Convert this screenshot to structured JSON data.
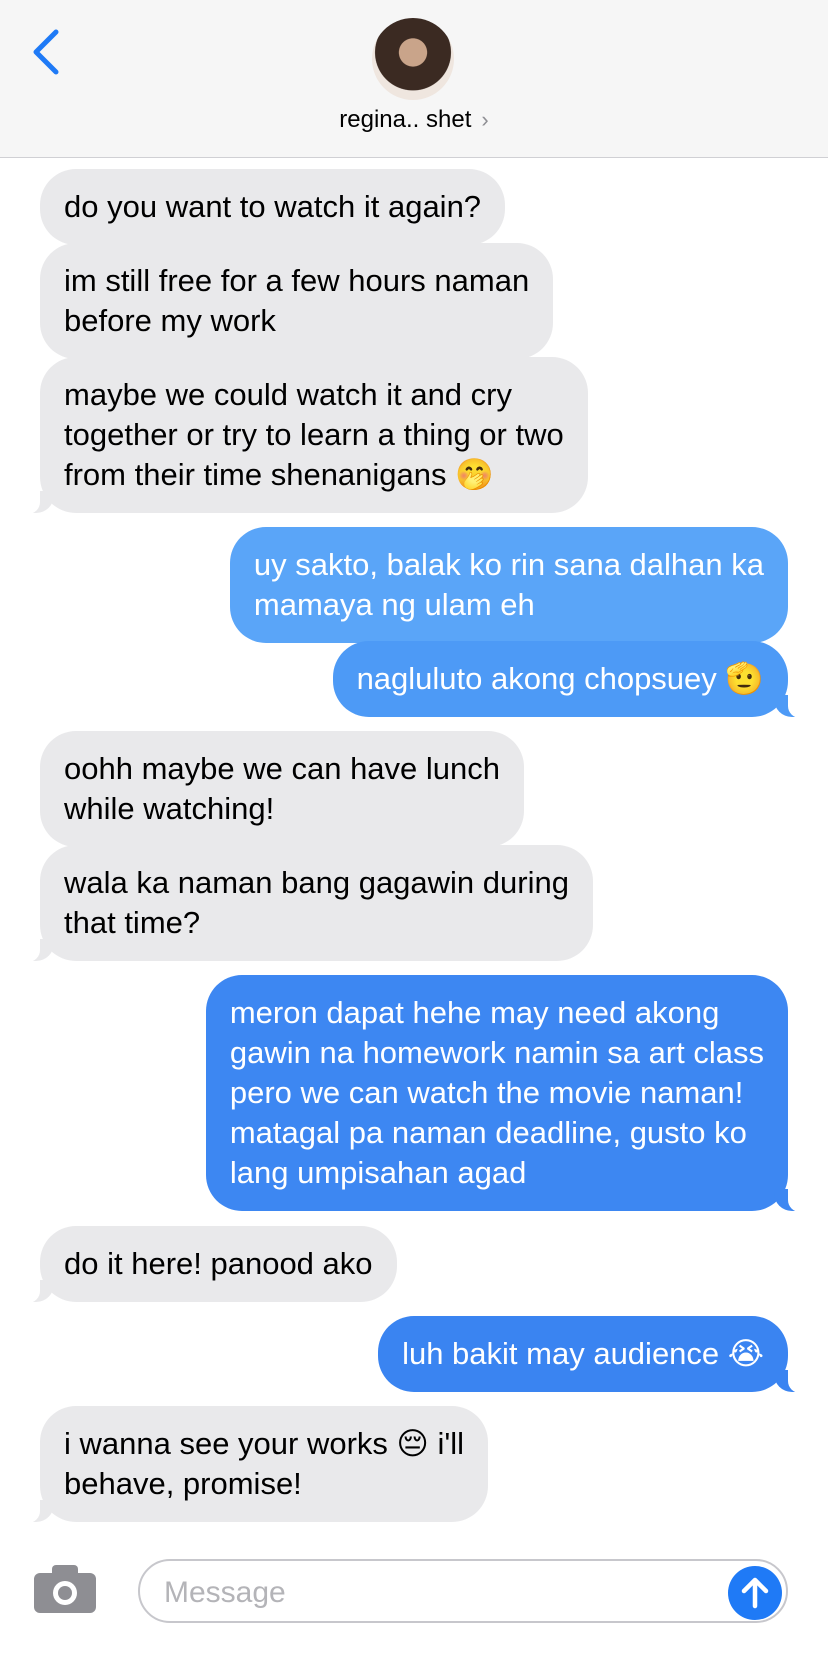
{
  "header": {
    "contact_name": "regina.. shet",
    "chevron": "›"
  },
  "icons": {
    "back": "chevron-left-icon",
    "camera": "camera-icon",
    "send": "arrow-up-icon"
  },
  "colors": {
    "accent": "#1f7af6",
    "received_bubble": "#e9e9eb",
    "sent_bubble_light": "#5aa5f8",
    "sent_bubble_dark": "#3d87f2"
  },
  "messages": [
    {
      "from": "them",
      "lines": [
        "do you want to watch it again?"
      ]
    },
    {
      "from": "them",
      "lines": [
        "im still free for a few hours naman",
        "before my work"
      ]
    },
    {
      "from": "them",
      "lines": [
        "maybe we could watch it and cry",
        "together or try to learn a thing or two",
        "from their time shenanigans 🤭"
      ]
    },
    {
      "from": "me",
      "lines": [
        "uy sakto, balak ko rin sana dalhan ka",
        "mamaya ng ulam eh"
      ]
    },
    {
      "from": "me",
      "lines": [
        "nagluluto akong chopsuey 🫡"
      ]
    },
    {
      "from": "them",
      "lines": [
        "oohh maybe we can have lunch",
        "while watching!"
      ]
    },
    {
      "from": "them",
      "lines": [
        "wala ka naman bang gagawin during",
        "that time?"
      ]
    },
    {
      "from": "me",
      "lines": [
        "meron dapat hehe may need akong",
        "gawin na homework namin sa art class",
        "pero we can watch the movie naman!",
        "matagal pa naman deadline, gusto ko",
        "lang umpisahan agad"
      ]
    },
    {
      "from": "them",
      "lines": [
        "do it here! panood ako"
      ]
    },
    {
      "from": "me",
      "lines": [
        "luh bakit may audience 😭"
      ]
    },
    {
      "from": "them",
      "lines": [
        "i wanna see your works 😔 i'll",
        "behave, promise!"
      ]
    }
  ],
  "composer": {
    "placeholder": "Message"
  }
}
